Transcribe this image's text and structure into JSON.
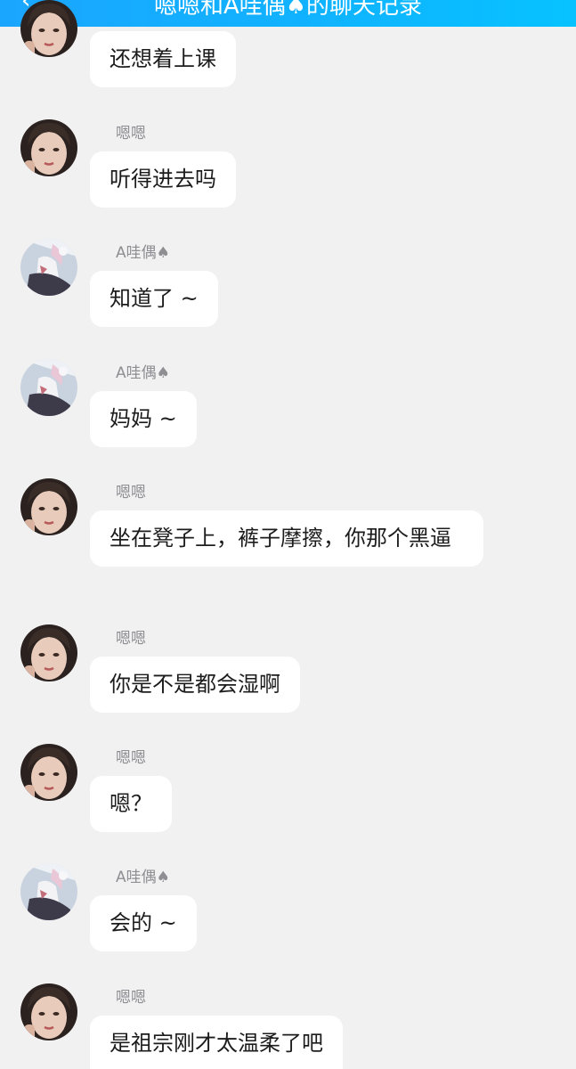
{
  "header": {
    "back_icon": "chevron-left-icon",
    "title": "嗯嗯和A哇偶♠的聊天记录"
  },
  "colors": {
    "header_gradient_start": "#1aa6ff",
    "header_gradient_end": "#07c2ff",
    "background": "#f1f1f1",
    "bubble": "#ffffff",
    "sender_text": "#8e8e93",
    "message_text": "#1c1c1c"
  },
  "messages": [
    {
      "sender": "",
      "avatar": "avatar-girl",
      "text": "还想着上课"
    },
    {
      "sender": "嗯嗯",
      "avatar": "avatar-girl",
      "text": "听得进去吗"
    },
    {
      "sender": "A哇偶♠",
      "avatar": "avatar-anime",
      "text": "知道了 ~"
    },
    {
      "sender": "A哇偶♠",
      "avatar": "avatar-anime",
      "text": "妈妈 ~"
    },
    {
      "sender": "嗯嗯",
      "avatar": "avatar-girl",
      "text": "坐在凳子上，裤子摩擦，你那个黑逼"
    },
    {
      "sender": "嗯嗯",
      "avatar": "avatar-girl",
      "text": "你是不是都会湿啊"
    },
    {
      "sender": "嗯嗯",
      "avatar": "avatar-girl",
      "text": "嗯？"
    },
    {
      "sender": "A哇偶♠",
      "avatar": "avatar-anime",
      "text": "会的 ~"
    },
    {
      "sender": "嗯嗯",
      "avatar": "avatar-girl",
      "text": "是祖宗刚才太温柔了吧"
    }
  ]
}
